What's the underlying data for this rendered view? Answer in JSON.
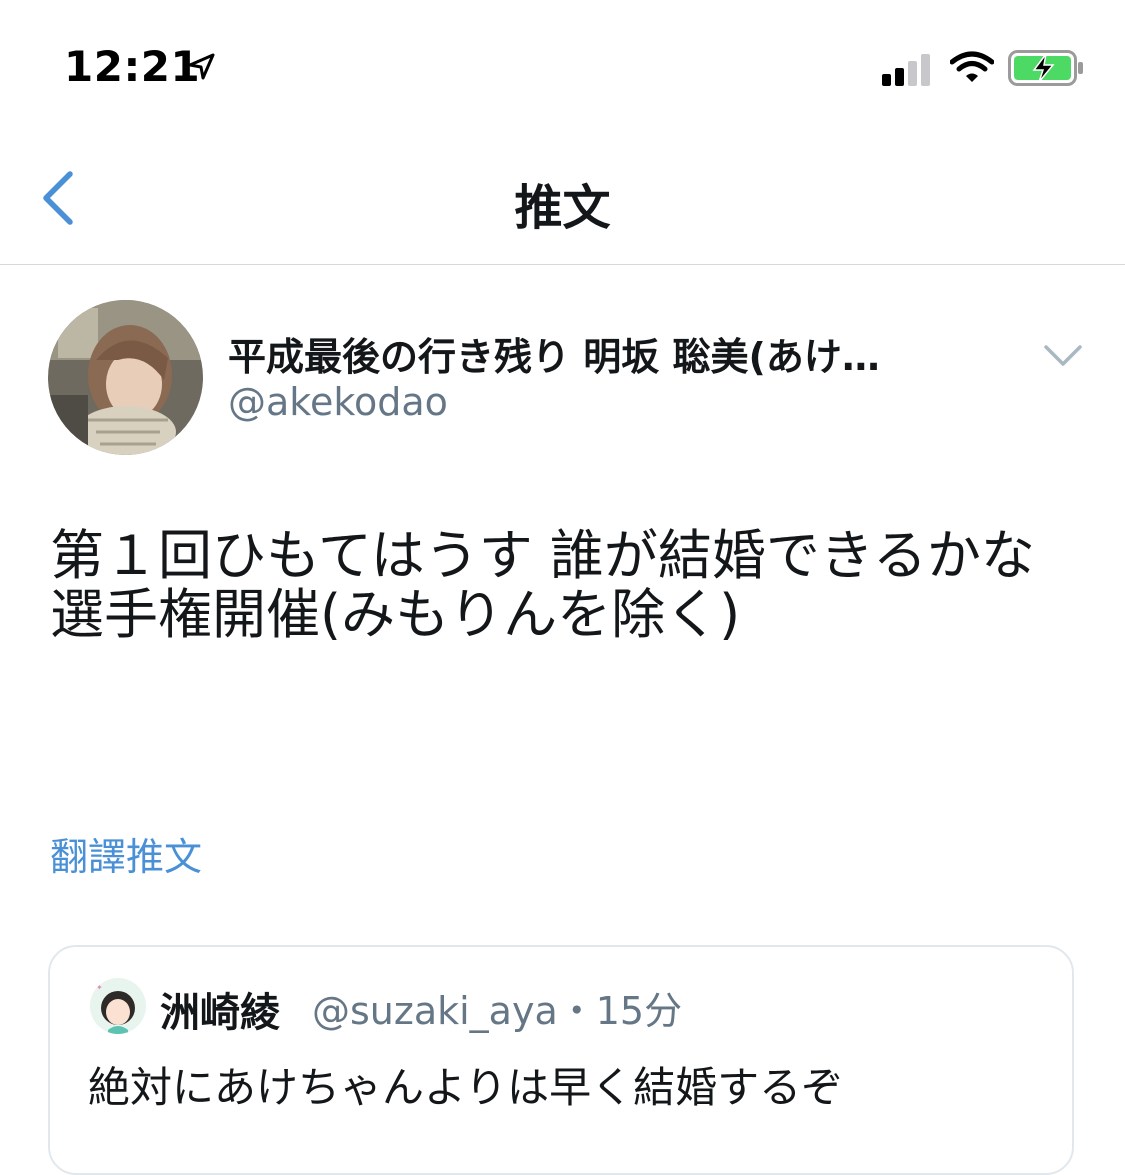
{
  "status_bar": {
    "time": "12:21",
    "icons": [
      "location-arrow-icon",
      "cellular-signal-icon",
      "wifi-icon",
      "battery-charging-icon"
    ]
  },
  "nav": {
    "back_icon": "chevron-left-icon",
    "title": "推文"
  },
  "tweet": {
    "display_name": "平成最後の行き残り 明坂 聡美(あけ…",
    "handle": "@akekodao",
    "text": "第１回ひもてはうす 誰が結婚できるかな選手権開催(みもりんを除く)",
    "translate_label": "翻譯推文",
    "more_icon": "chevron-down-icon"
  },
  "quoted_tweet": {
    "display_name": "洲崎綾",
    "meta": "@suzaki_aya・15分",
    "text": "絶対にあけちゃんよりは早く結婚するぞ"
  },
  "colors": {
    "accent": "#1da1f2",
    "link": "#4a90d6",
    "secondary_text": "#657786",
    "divider": "#d6d9dc",
    "battery_green": "#4cd964"
  }
}
